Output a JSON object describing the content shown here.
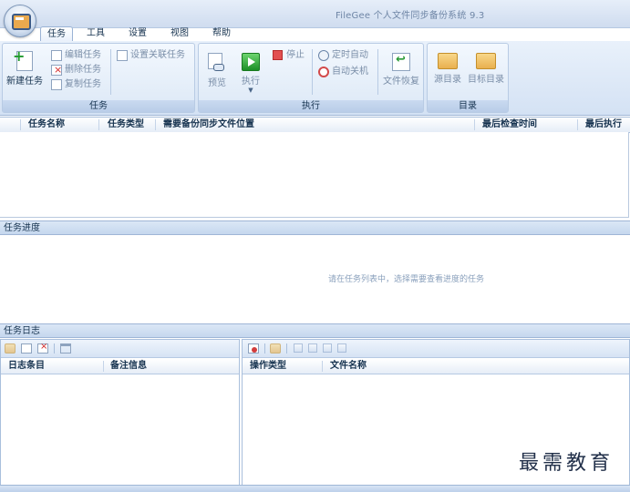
{
  "window": {
    "title": "FileGee 个人文件同步备份系统 9.3"
  },
  "tabs": [
    "任务",
    "工具",
    "设置",
    "视图",
    "帮助"
  ],
  "ribbon": {
    "task_group": {
      "label": "任务",
      "new_task": "新建任务",
      "edit_task": "编辑任务",
      "delete_task": "删除任务",
      "copy_task": "复制任务",
      "set_linked_task": "设置关联任务"
    },
    "exec_group": {
      "label": "执行",
      "preview": "预览",
      "execute": "执行",
      "stop": "停止",
      "scheduled_auto": "定时自动",
      "auto_shutdown": "自动关机",
      "file_restore": "文件恢复"
    },
    "dir_group": {
      "label": "目录",
      "source_dir": "源目录",
      "target_dir": "目标目录"
    }
  },
  "task_list": {
    "columns": [
      "任务名称",
      "任务类型",
      "需要备份同步文件位置",
      "最后检查时间",
      "最后执行时"
    ]
  },
  "progress": {
    "title": "任务进度",
    "empty_message": "请在任务列表中，选择需要查看进度的任务"
  },
  "log": {
    "title": "任务日志",
    "left_columns": [
      "日志条目",
      "备注信息"
    ],
    "right_columns": [
      "操作类型",
      "文件名称"
    ]
  },
  "watermark": "最需教育",
  "colors": {
    "ribbon_bg": "#d4e2f4",
    "section_bg": "#c5d7ee",
    "accent": "#2f9a3a"
  }
}
